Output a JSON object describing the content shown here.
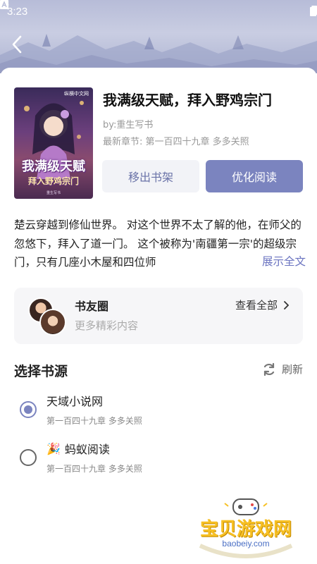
{
  "status_bar": {
    "time": "3:23"
  },
  "header": {
    "back_icon": "chevron-left-icon"
  },
  "book": {
    "title": "我满级天赋，拜入野鸡宗门",
    "author": "by:重生写书",
    "latest_chapter": "最新章节: 第一百四十九章 多多关照",
    "cover": {
      "title": "我满级天赋",
      "subtitle": "拜入野鸡宗门",
      "badge": "纵横中文网",
      "author": "重生写书"
    }
  },
  "actions": {
    "remove_label": "移出书架",
    "read_label": "优化阅读"
  },
  "intro": {
    "text": "楚云穿越到修仙世界。 对这个世界不太了解的他，在师父的忽悠下，拜入了道一门。 这个被称为'南疆第一宗'的超级宗门，只有几座小木屋和四位师",
    "expand_label": "展示全文"
  },
  "book_circle": {
    "title": "书友圈",
    "subtitle": "更多精彩内容",
    "view_all_label": "查看全部"
  },
  "sources": {
    "header": "选择书源",
    "refresh_label": "刷新",
    "items": [
      {
        "name": "天域小说网",
        "chapter": "第一百四十九章 多多关照",
        "selected": true,
        "emoji": ""
      },
      {
        "name": "蚂蚁阅读",
        "chapter": "第一百四十九章 多多关照",
        "selected": false,
        "emoji": "🎉"
      }
    ]
  },
  "watermark": {
    "text": "宝贝游戏网",
    "url": "baobeiy.com"
  },
  "colors": {
    "accent": "#7b84bf",
    "accent_light": "#f2f3f7",
    "link": "#6a73c0"
  }
}
